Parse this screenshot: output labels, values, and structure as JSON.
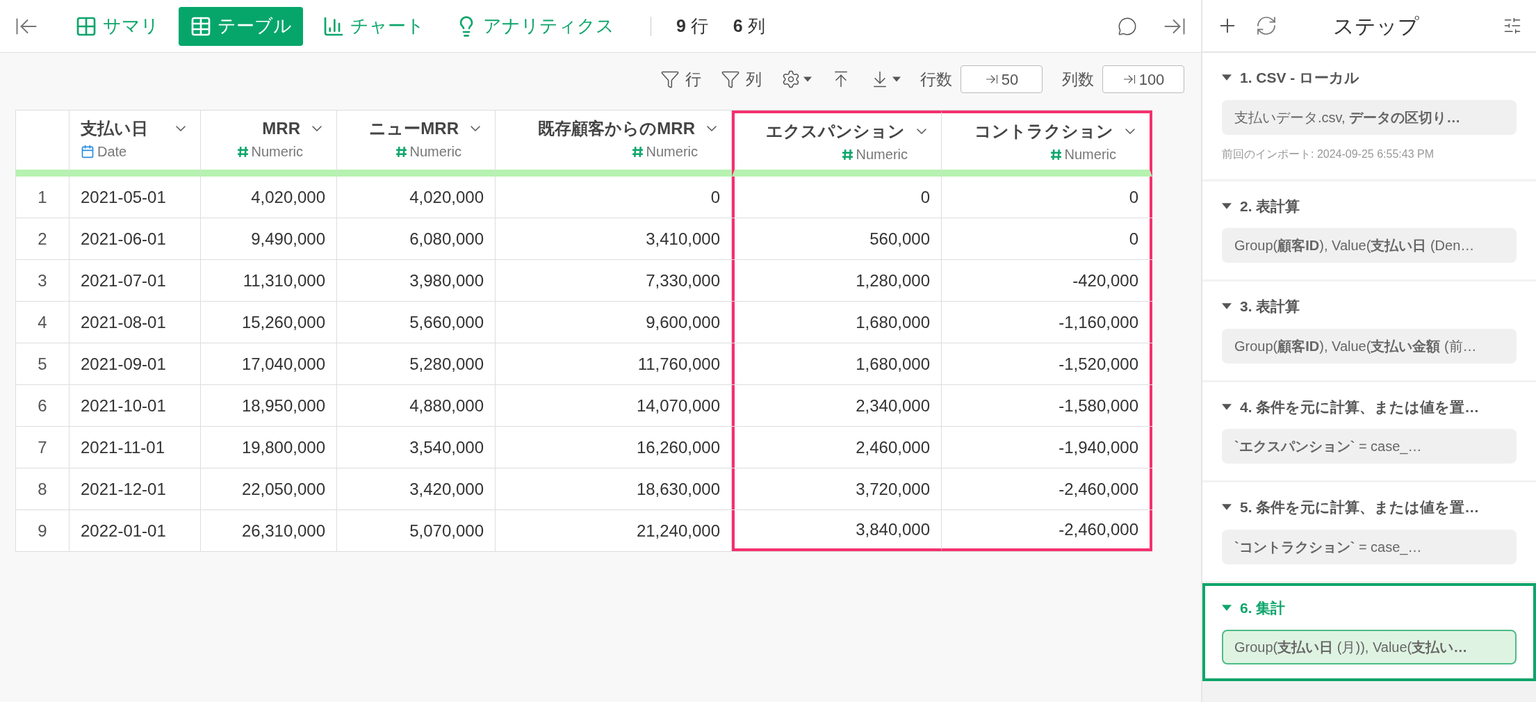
{
  "view_tabs": [
    {
      "label": "サマリ",
      "selected": false
    },
    {
      "label": "テーブル",
      "selected": true
    },
    {
      "label": "チャート",
      "selected": false
    },
    {
      "label": "アナリティクス",
      "selected": false
    }
  ],
  "counts": [
    "**9** 行",
    "**6** 列"
  ],
  "toolbar": {
    "row_filter": "行",
    "column_filter": "列",
    "rows_label": "行数",
    "rows_value": "50",
    "cols_label": "列数",
    "cols_value": "100"
  },
  "table": {
    "columns": [
      {
        "kind": "index",
        "highlighted": false
      },
      {
        "name": "支払い日",
        "type": "Date",
        "kind": "date",
        "highlighted": false
      },
      {
        "name": "MRR",
        "type": "Numeric",
        "kind": "numeric",
        "highlighted": false
      },
      {
        "name": "ニューMRR",
        "type": "Numeric",
        "kind": "numeric",
        "highlighted": false
      },
      {
        "name": "既存顧客からのMRR",
        "type": "Numeric",
        "kind": "numeric",
        "highlighted": false
      },
      {
        "name": "エクスパンション",
        "type": "Numeric",
        "kind": "numeric",
        "highlighted": true
      },
      {
        "name": "コントラクション",
        "type": "Numeric",
        "kind": "numeric",
        "highlighted": true
      }
    ],
    "rows": [
      [
        "1",
        "2021-05-01",
        "4,020,000",
        "4,020,000",
        "0",
        "0",
        "0"
      ],
      [
        "2",
        "2021-06-01",
        "9,490,000",
        "6,080,000",
        "3,410,000",
        "560,000",
        "0"
      ],
      [
        "3",
        "2021-07-01",
        "11,310,000",
        "3,980,000",
        "7,330,000",
        "1,280,000",
        "-420,000"
      ],
      [
        "4",
        "2021-08-01",
        "15,260,000",
        "5,660,000",
        "9,600,000",
        "1,680,000",
        "-1,160,000"
      ],
      [
        "5",
        "2021-09-01",
        "17,040,000",
        "5,280,000",
        "11,760,000",
        "1,680,000",
        "-1,520,000"
      ],
      [
        "6",
        "2021-10-01",
        "18,950,000",
        "4,880,000",
        "14,070,000",
        "2,340,000",
        "-1,580,000"
      ],
      [
        "7",
        "2021-11-01",
        "19,800,000",
        "3,540,000",
        "16,260,000",
        "2,460,000",
        "-1,940,000"
      ],
      [
        "8",
        "2021-12-01",
        "22,050,000",
        "3,420,000",
        "18,630,000",
        "3,720,000",
        "-2,460,000"
      ],
      [
        "9",
        "2022-01-01",
        "26,310,000",
        "5,070,000",
        "21,240,000",
        "3,840,000",
        "-2,460,000"
      ]
    ]
  },
  "steps_panel": {
    "title": "ステップ",
    "steps": [
      {
        "title": "1. CSV - ローカル",
        "summary": "支払いデータ.csv, **データの区切り…**",
        "note": "前回のインポート: 2024-09-25 6:55:43 PM",
        "selected": false
      },
      {
        "title": "2. 表計算",
        "summary": "Group(**顧客ID**), Value(**支払い日** (Den…",
        "selected": false
      },
      {
        "title": "3. 表計算",
        "summary": "Group(**顧客ID**), Value(**支払い金額** (前…",
        "selected": false
      },
      {
        "title": "4. 条件を元に計算、または値を置…",
        "summary": "**`エクスパンション`** = case_…",
        "selected": false
      },
      {
        "title": "5. 条件を元に計算、または値を置…",
        "summary": "**`コントラクション`** = case_…",
        "selected": false
      },
      {
        "title": "6. 集計",
        "summary": "Group(**支払い日** (月)), Value(**支払い…**",
        "selected": true
      }
    ]
  }
}
